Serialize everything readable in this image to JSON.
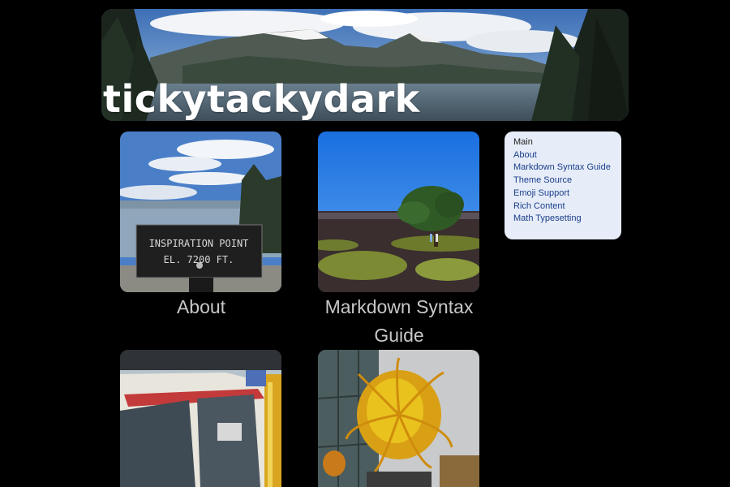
{
  "site": {
    "title": "tickytackydark"
  },
  "posts": [
    {
      "title": "About",
      "image": "inspiration-point-sign"
    },
    {
      "title": "Markdown Syntax Guide",
      "image": "lone-tree-lava-field"
    },
    {
      "title": "",
      "image": "monorail-car"
    },
    {
      "title": "",
      "image": "glass-sculpture"
    }
  ],
  "sidebar": {
    "current": "Main",
    "links": [
      "About",
      "Markdown Syntax Guide",
      "Theme Source",
      "Emoji Support",
      "Rich Content",
      "Math Typesetting"
    ]
  },
  "colors": {
    "background": "#000000",
    "title_text": "#ffffff",
    "card_title": "#c8c8c8",
    "sidebar_bg": "#e6ecf8",
    "sidebar_link": "#1a3f8a"
  }
}
